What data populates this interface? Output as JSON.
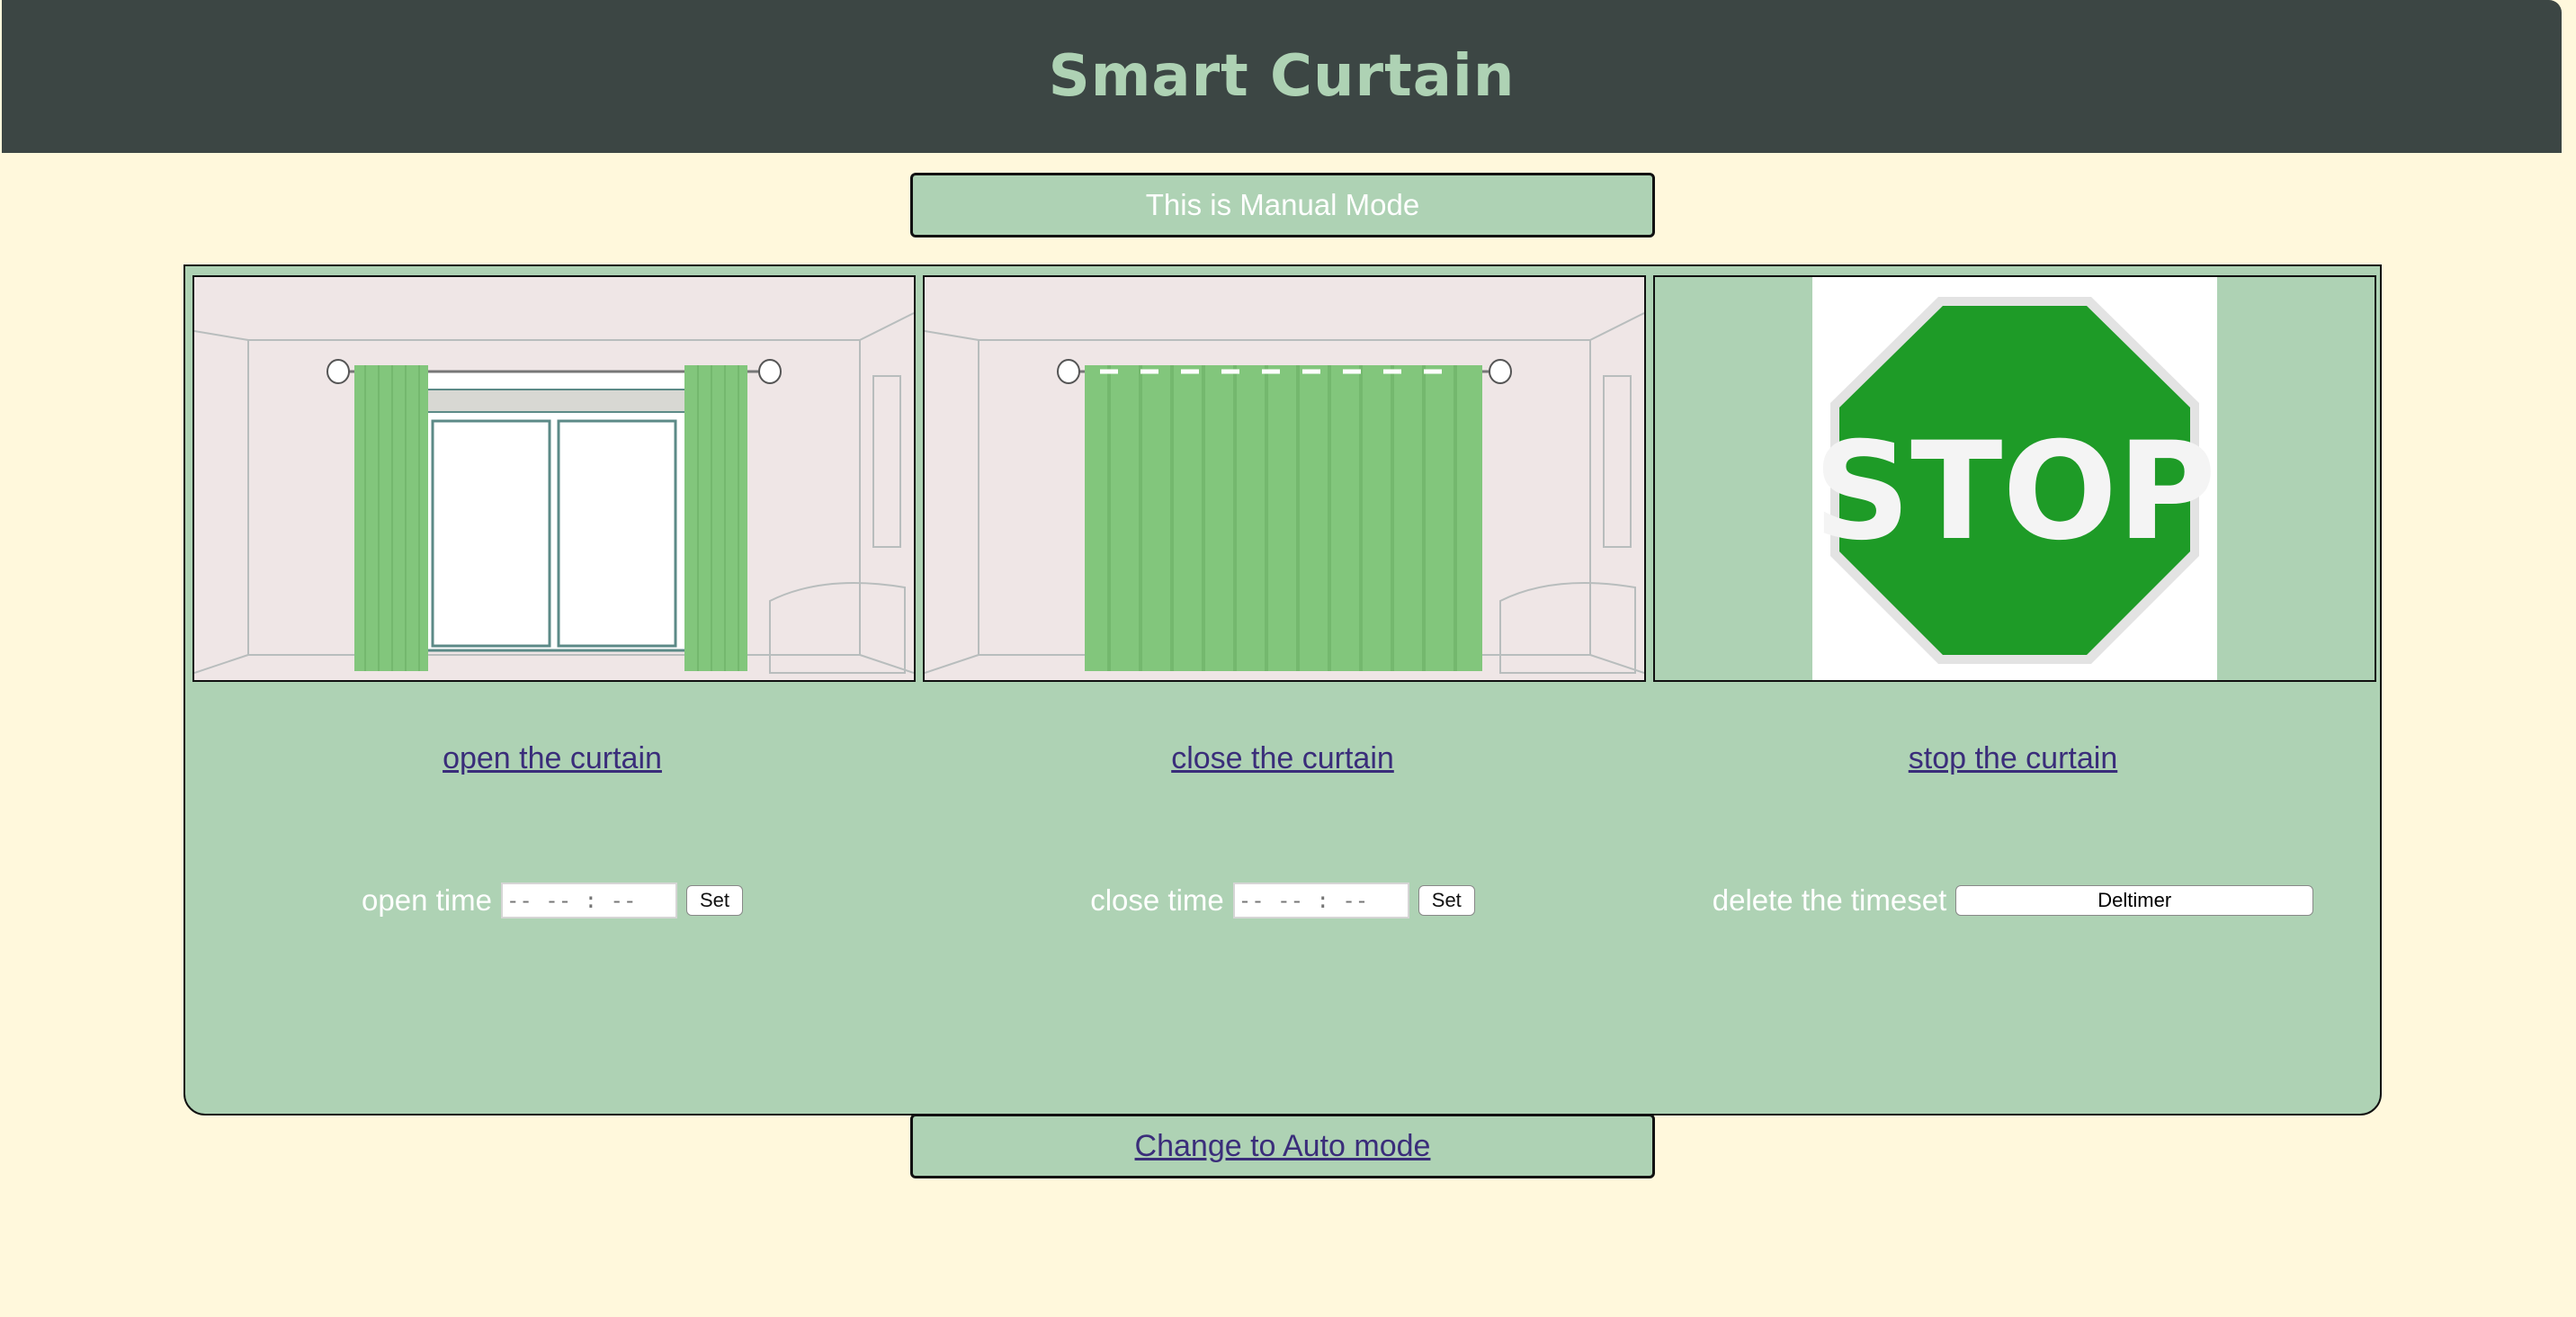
{
  "header": {
    "title": "Smart Curtain"
  },
  "mode": {
    "label": "This is Manual Mode"
  },
  "panels": [
    {
      "image": "open-curtain-image",
      "link": "open the curtain",
      "control_label": "open time",
      "time_placeholder": "-- -- : --",
      "button": "Set"
    },
    {
      "image": "closed-curtain-image",
      "link": "close the curtain",
      "control_label": "close time",
      "time_placeholder": "-- -- : --",
      "button": "Set"
    },
    {
      "image": "stop-sign-image",
      "sign_text": "STOP",
      "link": "stop the curtain",
      "control_label": "delete the timeset",
      "button": "Deltimer"
    }
  ],
  "footer": {
    "auto_link": "Change to Auto mode"
  },
  "colors": {
    "background": "#fff8dc",
    "header": "#3c4644",
    "title": "#aed2b4",
    "panel": "#aed2b4",
    "link": "#3a2d7a",
    "curtain": "#82c67c",
    "stop_green": "#1e9b27"
  }
}
